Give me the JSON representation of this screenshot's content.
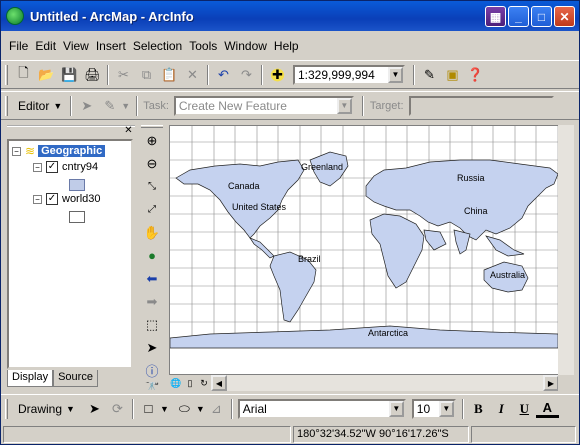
{
  "window": {
    "title": "Untitled - ArcMap - ArcInfo"
  },
  "menu": [
    "File",
    "Edit",
    "View",
    "Insert",
    "Selection",
    "Tools",
    "Window",
    "Help"
  ],
  "standard_toolbar": {
    "scale": "1:329,999,994"
  },
  "editor_toolbar": {
    "editor_label": "Editor",
    "task_label": "Task:",
    "task_value": "Create New Feature",
    "target_label": "Target:"
  },
  "toc": {
    "frame": "Geographic",
    "layers": [
      {
        "name": "cntry94",
        "checked": true,
        "swatch": "#c0cce8"
      },
      {
        "name": "world30",
        "checked": true,
        "swatch": "#ffffff"
      }
    ],
    "tabs": [
      "Display",
      "Source"
    ]
  },
  "map": {
    "land_color": "#c5d2ef",
    "labels": [
      "Greenland",
      "Canada",
      "United States",
      "Russia",
      "China",
      "Brazil",
      "Australia",
      "Antarctica"
    ]
  },
  "drawing_toolbar": {
    "drawing_label": "Drawing",
    "font": "Arial",
    "size": "10",
    "bold": "B",
    "italic": "I",
    "underline": "U",
    "fontcolor": "A"
  },
  "status": {
    "coords": "180°32'34.52\"W  90°16'17.26\"S"
  }
}
